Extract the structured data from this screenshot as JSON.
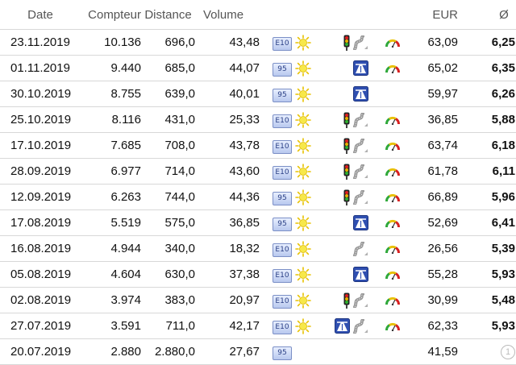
{
  "headers": {
    "date": "Date",
    "counter": "Compteur",
    "distance": "Distance",
    "volume": "Volume",
    "eur": "EUR",
    "avg": "Ø"
  },
  "rows": [
    {
      "date": "23.11.2019",
      "counter": "10.136",
      "distance": "696,0",
      "volume": "43,48",
      "fuel": "E10",
      "sun": true,
      "road": [
        "traffic-light",
        "country-road"
      ],
      "gauge": true,
      "eur": "63,09",
      "avg": "6,25"
    },
    {
      "date": "01.11.2019",
      "counter": "9.440",
      "distance": "685,0",
      "volume": "44,07",
      "fuel": "95",
      "sun": true,
      "road": [
        "highway"
      ],
      "gauge": true,
      "eur": "65,02",
      "avg": "6,35"
    },
    {
      "date": "30.10.2019",
      "counter": "8.755",
      "distance": "639,0",
      "volume": "40,01",
      "fuel": "95",
      "sun": true,
      "road": [
        "highway"
      ],
      "gauge": false,
      "eur": "59,97",
      "avg": "6,26"
    },
    {
      "date": "25.10.2019",
      "counter": "8.116",
      "distance": "431,0",
      "volume": "25,33",
      "fuel": "E10",
      "sun": true,
      "road": [
        "traffic-light",
        "country-road"
      ],
      "gauge": true,
      "eur": "36,85",
      "avg": "5,88"
    },
    {
      "date": "17.10.2019",
      "counter": "7.685",
      "distance": "708,0",
      "volume": "43,78",
      "fuel": "E10",
      "sun": true,
      "road": [
        "traffic-light",
        "country-road"
      ],
      "gauge": true,
      "eur": "63,74",
      "avg": "6,18"
    },
    {
      "date": "28.09.2019",
      "counter": "6.977",
      "distance": "714,0",
      "volume": "43,60",
      "fuel": "E10",
      "sun": true,
      "road": [
        "traffic-light",
        "country-road"
      ],
      "gauge": true,
      "eur": "61,78",
      "avg": "6,11"
    },
    {
      "date": "12.09.2019",
      "counter": "6.263",
      "distance": "744,0",
      "volume": "44,36",
      "fuel": "95",
      "sun": true,
      "road": [
        "traffic-light",
        "country-road"
      ],
      "gauge": true,
      "eur": "66,89",
      "avg": "5,96"
    },
    {
      "date": "17.08.2019",
      "counter": "5.519",
      "distance": "575,0",
      "volume": "36,85",
      "fuel": "95",
      "sun": true,
      "road": [
        "highway"
      ],
      "gauge": true,
      "eur": "52,69",
      "avg": "6,41"
    },
    {
      "date": "16.08.2019",
      "counter": "4.944",
      "distance": "340,0",
      "volume": "18,32",
      "fuel": "E10",
      "sun": true,
      "road": [
        "country-road"
      ],
      "gauge": true,
      "eur": "26,56",
      "avg": "5,39"
    },
    {
      "date": "05.08.2019",
      "counter": "4.604",
      "distance": "630,0",
      "volume": "37,38",
      "fuel": "E10",
      "sun": true,
      "road": [
        "highway"
      ],
      "gauge": true,
      "eur": "55,28",
      "avg": "5,93"
    },
    {
      "date": "02.08.2019",
      "counter": "3.974",
      "distance": "383,0",
      "volume": "20,97",
      "fuel": "E10",
      "sun": true,
      "road": [
        "traffic-light",
        "country-road"
      ],
      "gauge": true,
      "eur": "30,99",
      "avg": "5,48"
    },
    {
      "date": "27.07.2019",
      "counter": "3.591",
      "distance": "711,0",
      "volume": "42,17",
      "fuel": "E10",
      "sun": true,
      "road": [
        "highway",
        "country-road"
      ],
      "gauge": true,
      "eur": "62,33",
      "avg": "5,93"
    },
    {
      "date": "20.07.2019",
      "counter": "2.880",
      "distance": "2.880,0",
      "volume": "27,67",
      "fuel": "95",
      "sun": false,
      "road": [],
      "gauge": false,
      "eur": "41,59",
      "avg": "",
      "badge": "1"
    }
  ],
  "colors": {
    "fuel_badge": "#b8c8ee",
    "sun": "#f5e13a",
    "highway": "#2f4fb0",
    "avg_text": "#000000"
  }
}
